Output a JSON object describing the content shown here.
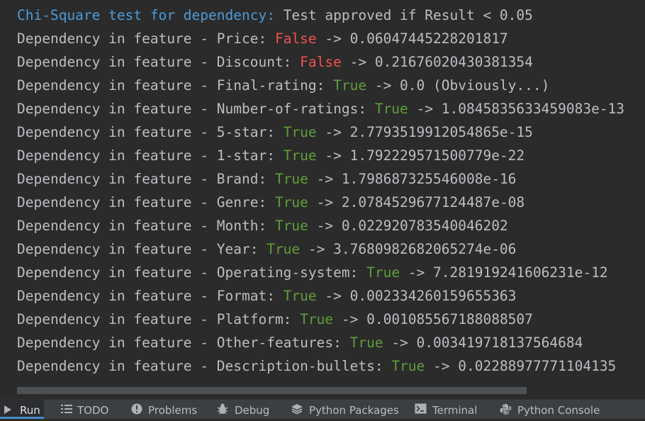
{
  "console": {
    "header": {
      "title": "Chi-Square test for dependency:",
      "text": " Test approved if Result < 0.05"
    },
    "rows": [
      {
        "prefix": "Dependency in feature - Price: ",
        "status": "False",
        "result": " -> 0.06047445228201817",
        "color": "#f0524f"
      },
      {
        "prefix": "Dependency in feature - Discount: ",
        "status": "False",
        "result": " -> 0.21676020430381354",
        "color": "#f0524f"
      },
      {
        "prefix": "Dependency in feature - Final-rating: ",
        "status": "True",
        "result": " -> 0.0 (Obviously...)",
        "color": "#5f9e3a"
      },
      {
        "prefix": "Dependency in feature - Number-of-ratings: ",
        "status": "True",
        "result": " -> 1.0845835633459083e-13",
        "color": "#5f9e3a"
      },
      {
        "prefix": "Dependency in feature - 5-star: ",
        "status": "True",
        "result": " -> 2.7793519912054865e-15",
        "color": "#5f9e3a"
      },
      {
        "prefix": "Dependency in feature - 1-star: ",
        "status": "True",
        "result": " -> 1.792229571500779e-22",
        "color": "#5f9e3a"
      },
      {
        "prefix": "Dependency in feature - Brand: ",
        "status": "True",
        "result": " -> 1.798687325546008e-16",
        "color": "#5f9e3a"
      },
      {
        "prefix": "Dependency in feature - Genre: ",
        "status": "True",
        "result": " -> 2.0784529677124487e-08",
        "color": "#5f9e3a"
      },
      {
        "prefix": "Dependency in feature - Month: ",
        "status": "True",
        "result": " -> 0.022920783540046202",
        "color": "#5f9e3a"
      },
      {
        "prefix": "Dependency in feature - Year: ",
        "status": "True",
        "result": " -> 3.7680982682065274e-06",
        "color": "#5f9e3a"
      },
      {
        "prefix": "Dependency in feature - Operating-system: ",
        "status": "True",
        "result": " -> 7.281919241606231e-12",
        "color": "#5f9e3a"
      },
      {
        "prefix": "Dependency in feature - Format: ",
        "status": "True",
        "result": " -> 0.002334260159655363",
        "color": "#5f9e3a"
      },
      {
        "prefix": "Dependency in feature - Platform: ",
        "status": "True",
        "result": " -> 0.001085567188088507",
        "color": "#5f9e3a"
      },
      {
        "prefix": "Dependency in feature - Other-features: ",
        "status": "True",
        "result": " -> 0.003419718137564684",
        "color": "#5f9e3a"
      },
      {
        "prefix": "Dependency in feature - Description-bullets: ",
        "status": "True",
        "result": " -> 0.02288977771104135",
        "color": "#5f9e3a"
      }
    ]
  },
  "toolbar": {
    "tabs": [
      {
        "label": "Run",
        "icon": "play-icon"
      },
      {
        "label": "TODO",
        "icon": "list-icon"
      },
      {
        "label": "Problems",
        "icon": "warning-icon"
      },
      {
        "label": "Debug",
        "icon": "bug-icon"
      },
      {
        "label": "Python Packages",
        "icon": "layers-icon"
      },
      {
        "label": "Terminal",
        "icon": "terminal-icon"
      },
      {
        "label": "Python Console",
        "icon": "python-icon"
      }
    ]
  },
  "colors": {
    "background": "#2b2b2b",
    "text": "#bcbec4",
    "header": "#4d9bd8",
    "false": "#f0524f",
    "true": "#5f9e3a",
    "toolbar": "#3c3f41"
  }
}
